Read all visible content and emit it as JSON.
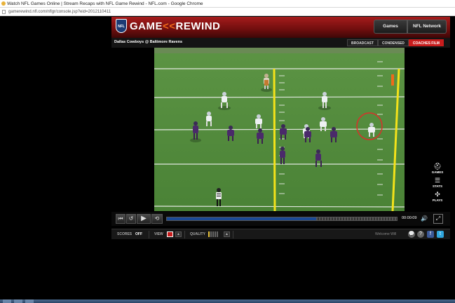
{
  "browser": {
    "window_title": "Watch NFL Games Online | Stream Recaps with NFL Game Rewind - NFL.com - Google Chrome",
    "url": "gamerewind.nfl.com/nflgr/console.jsp?eid=2012110411"
  },
  "header": {
    "logo_shield": "NFL",
    "logo_word1": "GAME",
    "logo_arrows": "<<",
    "logo_word2": "REWIND",
    "nav_games": "Games",
    "nav_network": "NFL Network"
  },
  "subbar": {
    "game_title": "Dallas Cowboys @ Baltimore Ravens",
    "view_modes": [
      "BROADCAST",
      "CONDENSED",
      "COACHES FILM"
    ],
    "active_mode": "COACHES FILM"
  },
  "side_controls": [
    {
      "icon": "helmet-icon",
      "glyph": "⛑",
      "label": "GAMES"
    },
    {
      "icon": "stats-list-icon",
      "glyph": "☰",
      "label": "STATS"
    },
    {
      "icon": "plays-icon",
      "glyph": "✣",
      "label": "PLAYS"
    }
  ],
  "player": {
    "time": "00:00:09",
    "progress": 0.65,
    "buffered": 1.0
  },
  "bottombar": {
    "scores_label": "SCORES",
    "scores_value": "OFF",
    "view_label": "VIEW",
    "quality_label": "QUALITY",
    "quality_level": 1,
    "quality_max": 5,
    "welcome": "Welcome Will"
  },
  "colors": {
    "brand_red": "#c81d1d",
    "progress_blue": "#1b4a96",
    "field_green": "#4f8a3a",
    "ravens_purple": "#4a2a6a",
    "cowboys_white": "#e8ecef",
    "circle_red": "#d9302a"
  }
}
